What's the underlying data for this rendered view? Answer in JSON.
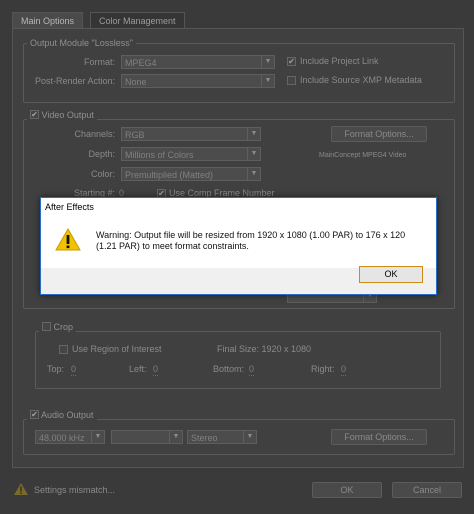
{
  "tabs": [
    "Main Options",
    "Color Management"
  ],
  "output_module": {
    "group_label": "Output Module \"Lossless\"",
    "format_label": "Format:",
    "format_value": "MPEG4",
    "post_render_label": "Post-Render Action:",
    "post_render_value": "None",
    "include_project_link": "Include Project Link",
    "include_xmp": "Include Source XMP Metadata"
  },
  "video_output": {
    "label": "Video Output",
    "channels_label": "Channels:",
    "channels_value": "RGB",
    "depth_label": "Depth:",
    "depth_value": "Millions of Colors",
    "color_label": "Color:",
    "color_value": "Premultiplied (Matted)",
    "format_options_btn": "Format Options...",
    "codec_text": "MainConcept MPEG4 Video",
    "starting_label": "Starting #:",
    "starting_value": "0",
    "use_comp_frame": "Use Comp Frame Number"
  },
  "crop": {
    "label": "Crop",
    "use_roi": "Use Region of Interest",
    "final_size": "Final Size: 1920 x 1080",
    "top_label": "Top:",
    "top_value": "0",
    "left_label": "Left:",
    "left_value": "0",
    "bottom_label": "Bottom:",
    "bottom_value": "0",
    "right_label": "Right:",
    "right_value": "0"
  },
  "audio_output": {
    "label": "Audio Output",
    "rate_value": "48.000 kHz",
    "channels_value": "Stereo",
    "format_options_btn": "Format Options..."
  },
  "footer": {
    "warning_text": "Settings mismatch...",
    "ok_label": "OK",
    "cancel_label": "Cancel"
  },
  "dialog": {
    "title": "After Effects",
    "message": "Warning: Output file will be resized from 1920 x 1080 (1.00 PAR) to 176 x 120 (1.21 PAR) to meet format constraints.",
    "ok_label": "OK"
  },
  "colors": {
    "dialog_border": "#2b6cc4",
    "ok_focus": "#d08a16",
    "warning_icon": "#f2c200"
  }
}
